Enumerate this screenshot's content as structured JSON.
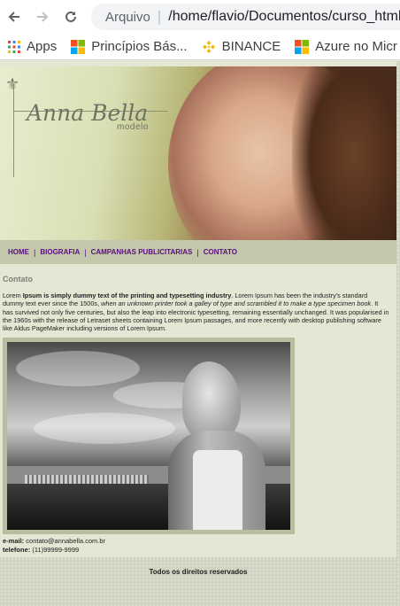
{
  "browser": {
    "scheme_label": "Arquivo",
    "url": "/home/flavio/Documentos/curso_html-e",
    "bookmarks": [
      {
        "label": "Apps",
        "icon": "apps-grid-icon"
      },
      {
        "label": "Princípios Bás...",
        "icon": "microsoft-logo-icon"
      },
      {
        "label": "BINANCE",
        "icon": "binance-logo-icon"
      },
      {
        "label": "Azure no Micr",
        "icon": "microsoft-logo-icon"
      }
    ]
  },
  "site": {
    "brand": "Anna Bella",
    "brand_sub": "modelo",
    "menu": [
      "HOME",
      "BIOGRAFIA",
      "CAMPANHAS PUBLICITARIAS",
      "CONTATO"
    ],
    "section_title": "Contato",
    "paragraph": {
      "p1": "Lorem ",
      "p2": "Ipsum is simply dummy text of the printing and typesetting industry",
      "p3": ". Lorem Ipsum has been the industry's standard dummy text ever since the 1500s, ",
      "p4": "when an unknown printer took a galley of type and scrambled it to make a type specimen book",
      "p5": ". It has survived not only five centuries, but also the leap into electronic typesetting, remaining essentially unchanged. It was popularised in the 1960s with the release of Letraset sheets containing Lorem Ipsum passages, and more recently with desktop publishing software like Aldus PageMaker including versions of Lorem Ipsum."
    },
    "contact": {
      "email_label": "e-mail:",
      "email": "contato@annabella.com.br",
      "phone_label": "telefone:",
      "phone": "(11)99999-9999"
    },
    "footer": "Todos os direitos reservados"
  },
  "colors": {
    "menu_link": "#5a0f7a",
    "page_bg": "#e4e7d3",
    "menu_bg": "#c3c8ad"
  }
}
